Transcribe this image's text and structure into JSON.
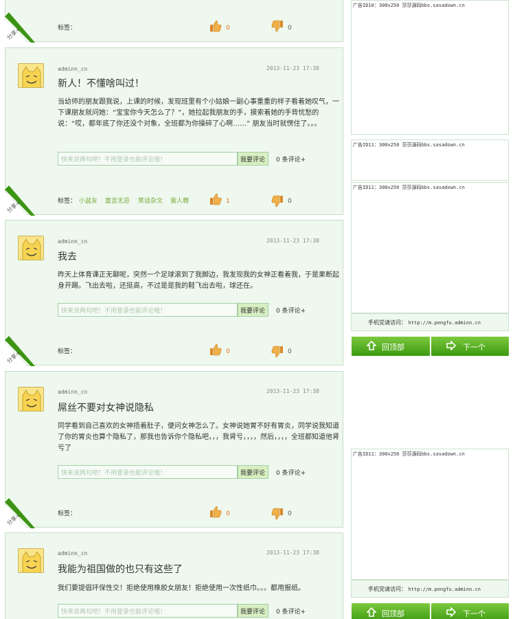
{
  "common": {
    "tag_label": "标签：",
    "comment_placeholder": "快来说两句吧！不用登录也能评论哦！",
    "comment_button": "我要评论",
    "comment_suffix": "0 条评论+",
    "share_label": "分享+",
    "author": "adminn_cn"
  },
  "posts": [
    {
      "likes": "0",
      "dislikes": "0"
    },
    {
      "time": "2013-11-23 17:38",
      "title": "新人！不懂啥叫过！",
      "body": "当幼师的朋友跟我说，上课的时候，发现班里有个小姑娘一副心事重重的样子看着她叹气，一下课朋友就问她：“宝宝你今天怎么了？”，她拉起我朋友的手，摸索着她的手背忧愁的说：“哎，都年底了你还没个对象，全班都为你操碎了心啊……” 朋友当时就愣住了。。。",
      "tags": [
        "小盆友",
        "童言无忌",
        "笑话杂文",
        "雷人糗"
      ],
      "likes": "1",
      "dislikes": "0"
    },
    {
      "time": "2013-11-23 17:38",
      "title": "我去",
      "body": "昨天上体育课正无聊呢，突然一个足球滚到了我脚边，我发现我的女神正看着我，于是果断起身开踢。飞出去啦，还挺高，不过是是我的鞋飞出去啦，球还在。",
      "likes": "0",
      "dislikes": "0"
    },
    {
      "time": "2013-11-23 17:38",
      "title": "屌丝不要对女神说隐私",
      "body": "同学看到自己喜欢的女神捂着肚子，便问女神怎么了。女神说她胃不好有胃炎，同学说我知道了你的胃炎也算个隐私了，那我也告诉你个隐私吧，，，我肾亏，，，，然后，，，，全班都知道他肾亏了",
      "likes": "0",
      "dislikes": "0"
    },
    {
      "time": "2013-11-23 17:38",
      "title": "我能为祖国做的也只有这些了",
      "body": "我们要提倡环保性交！拒绝使用橡胶女朋友！拒绝使用一次性纸巾。。。都用报纸。"
    }
  ],
  "sidebar": {
    "ad1": "广告ID10：300x250 莎莎源码bbs.sasadown.cn",
    "ad2": "广告ID11：300x250 莎莎源码bbs.sasadown.cn",
    "ad3": "广告ID11：300x250 莎莎源码bbs.sasadown.cn",
    "ad4": "广告ID11：300x250 莎莎源码bbs.sasadown.cn",
    "mobile_label": "手机党请访问：",
    "mobile_url": "http://m.pengfu.adminn.cn",
    "back_to_top": "回顶部",
    "next": "下一个"
  },
  "colors": {
    "post_bg": "#eef8ee",
    "accent_green": "#5fb32a",
    "like_orange": "#e06f1a",
    "tag_green": "#7ba83a"
  }
}
